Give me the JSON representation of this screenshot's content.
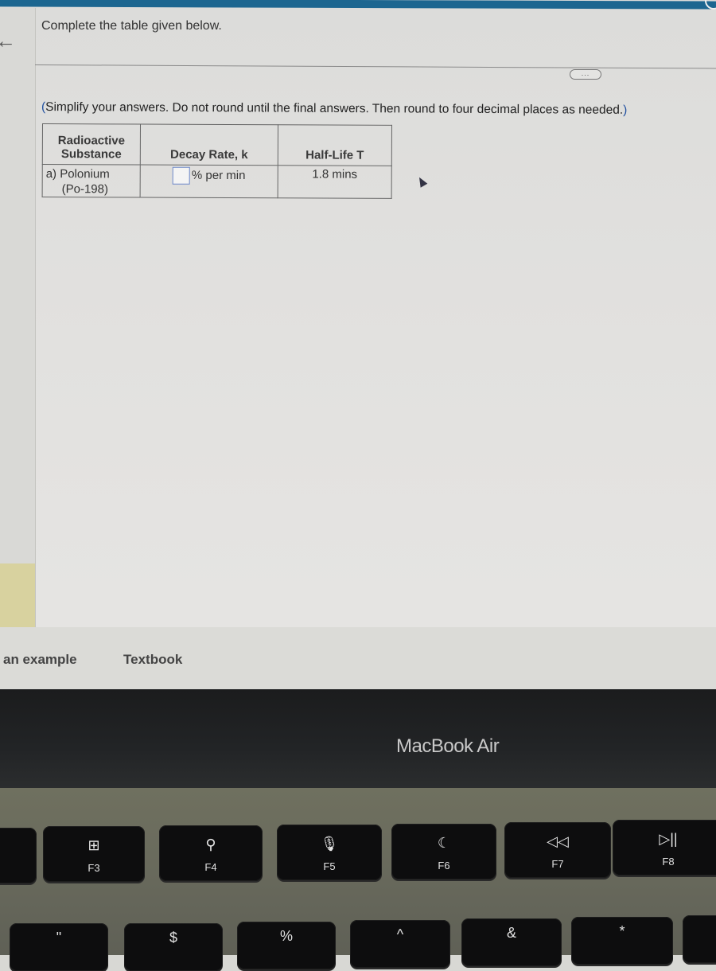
{
  "screen": {
    "prompt": "Complete the table given below.",
    "more_button": "...",
    "instructions_prefix": "(",
    "instructions_body": "Simplify your answers. Do not round until the final answers. Then round to four decimal places as needed.",
    "instructions_suffix": ")",
    "table": {
      "headers": [
        "Radioactive Substance",
        "Decay Rate, k",
        "Half-Life T"
      ],
      "header_lines": {
        "substance_1": "Radioactive",
        "substance_2": "Substance"
      },
      "rows": [
        {
          "substance_line1": "a) Polonium",
          "substance_line2": "(Po-198)",
          "decay_rate_value": "",
          "decay_rate_unit": "% per min",
          "half_life": "1.8 mins"
        }
      ]
    },
    "footer": {
      "example_link": "an example",
      "textbook_link": "Textbook"
    }
  },
  "device": {
    "brand": "MacBook Air"
  },
  "keyboard": {
    "function_keys": [
      {
        "label": "F3",
        "icon": "mission-control-icon",
        "glyph": "⊞"
      },
      {
        "label": "F4",
        "icon": "search-icon",
        "glyph": "⚲"
      },
      {
        "label": "F5",
        "icon": "microphone-icon",
        "glyph": "🎙"
      },
      {
        "label": "F6",
        "icon": "moon-icon",
        "glyph": "☾"
      },
      {
        "label": "F7",
        "icon": "rewind-icon",
        "glyph": "◁◁"
      },
      {
        "label": "F8",
        "icon": "play-pause-icon",
        "glyph": "▷||"
      }
    ],
    "row2_symbols": [
      "\"",
      "$",
      "%",
      "^",
      "&",
      "*"
    ]
  }
}
